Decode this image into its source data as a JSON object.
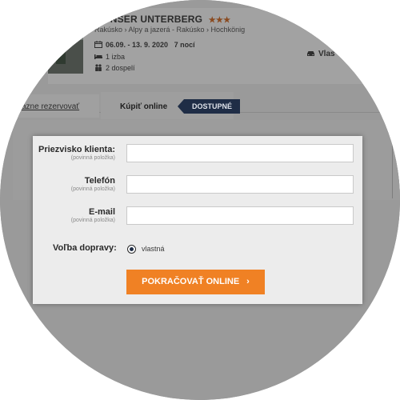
{
  "hotel": {
    "title": "L UNSER UNTERBERG",
    "stars": "★★★",
    "breadcrumb": "Rakúsko › Alpy a jazerá - Rakúsko › Hochkönig",
    "dates": "06.09. - 13. 9. 2020",
    "nights": "7 nocí",
    "room": "1 izba",
    "people": "2 dospelí",
    "transport_short": "Vlas"
  },
  "tabs": {
    "reserve_label": "vazne rezervovať",
    "buy_label": "Kúpiť online",
    "badge": "DOSTUPNÉ"
  },
  "form": {
    "surname_label": "Priezvisko klienta:",
    "surname_hint": "(povinná položka)",
    "surname_value": "",
    "phone_label": "Telefón",
    "phone_hint": "(povinná položka)",
    "phone_value": "",
    "email_label": "E-mail",
    "email_hint": "(povinná položka)",
    "email_value": "",
    "transport_label": "Voľba dopravy:",
    "transport_option": "vlastná",
    "continue_label": "POKRAČOVAŤ ONLINE",
    "continue_chevron": "›"
  },
  "colors": {
    "accent": "#f08124",
    "badge_bg": "#1f2d46"
  }
}
